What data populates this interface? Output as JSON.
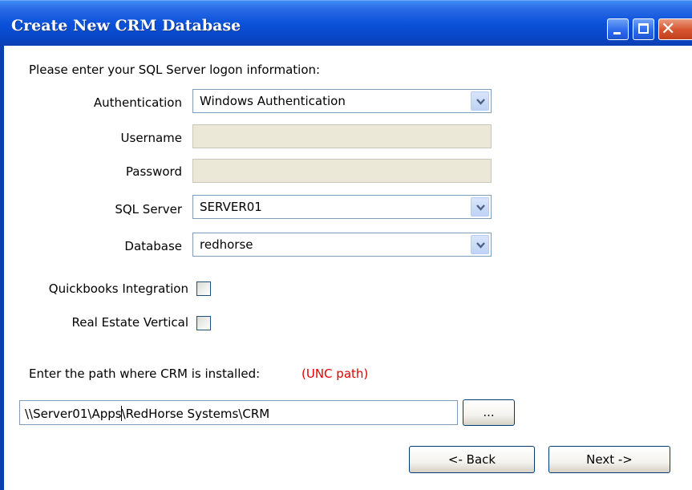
{
  "window": {
    "title": "Create New CRM Database"
  },
  "form": {
    "intro": "Please enter your SQL Server logon information:",
    "authentication": {
      "label": "Authentication",
      "value": "Windows Authentication"
    },
    "username": {
      "label": "Username",
      "value": ""
    },
    "password": {
      "label": "Password",
      "value": ""
    },
    "sql_server": {
      "label": "SQL Server",
      "value": "SERVER01"
    },
    "database": {
      "label": "Database",
      "value": "redhorse"
    },
    "quickbooks": {
      "label": "Quickbooks Integration",
      "checked": false
    },
    "real_estate": {
      "label": "Real Estate Vertical",
      "checked": false
    },
    "path_prompt": "Enter the path where CRM is installed:",
    "unc_hint": "(UNC path)",
    "path_before_caret": "\\\\Server01\\Apps",
    "path_after_caret": "\\RedHorse Systems\\CRM",
    "browse_label": "...",
    "back_label": "<- Back",
    "next_label": "Next ->"
  },
  "colors": {
    "titlebar": "#0B52DA",
    "hint_red": "#E00000",
    "disabled_field": "#EBE8D8"
  }
}
